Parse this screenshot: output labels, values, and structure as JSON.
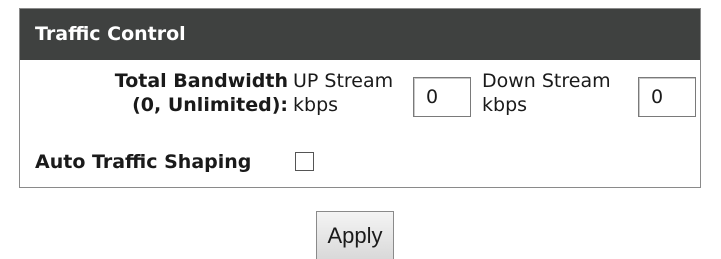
{
  "panel": {
    "title": "Traffic Control",
    "total_bandwidth": {
      "label_line1": "Total Bandwidth",
      "label_line2": "(0, Unlimited):",
      "up_label_line1": "UP Stream",
      "up_label_line2": "kbps",
      "up_value": "0",
      "down_label_line1": "Down Stream",
      "down_label_line2": "kbps",
      "down_value": "0"
    },
    "auto_traffic_shaping": {
      "label": "Auto Traffic Shaping",
      "checked": false
    }
  },
  "actions": {
    "apply_label": "Apply"
  }
}
